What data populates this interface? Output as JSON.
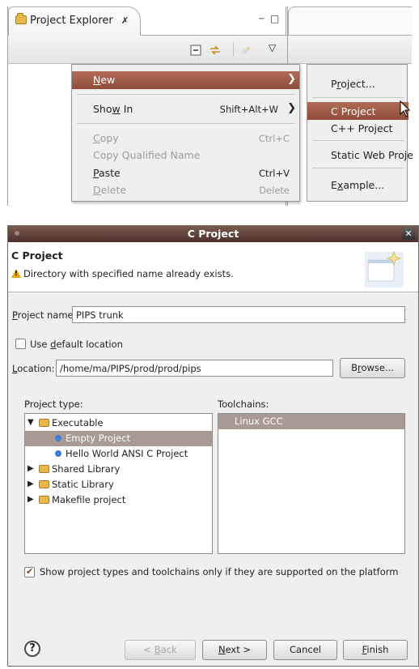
{
  "explorer": {
    "tab_title": "Project Explorer",
    "tab_close": "✗",
    "minimize": "−",
    "maximize": "□",
    "view_menu": "▽"
  },
  "context_menu": {
    "items": [
      {
        "label": "New",
        "mnemonic": "N",
        "accelerator": "",
        "has_submenu": true,
        "highlighted": true,
        "disabled": false
      },
      {
        "label": "Show In",
        "accelerator": "Shift+Alt+W",
        "has_submenu": true,
        "highlighted": false,
        "disabled": false
      },
      {
        "label": "Copy",
        "accelerator": "Ctrl+C",
        "has_submenu": false,
        "highlighted": false,
        "disabled": true
      },
      {
        "label": "Copy Qualified Name",
        "accelerator": "",
        "has_submenu": false,
        "highlighted": false,
        "disabled": true
      },
      {
        "label": "Paste",
        "accelerator": "Ctrl+V",
        "has_submenu": false,
        "highlighted": false,
        "disabled": false
      },
      {
        "label": "Delete",
        "accelerator": "Delete",
        "has_submenu": false,
        "highlighted": false,
        "disabled": true
      }
    ],
    "submenu_arrow": "❯"
  },
  "new_submenu": {
    "items": [
      {
        "label": "Project...",
        "highlighted": false
      },
      {
        "label": "C Project",
        "highlighted": true
      },
      {
        "label": "C++ Project",
        "highlighted": false
      },
      {
        "label": "Static Web Proje",
        "highlighted": false
      },
      {
        "label": "Example...",
        "highlighted": false
      }
    ]
  },
  "dialog": {
    "title": "C Project",
    "close": "✕",
    "header": "C Project",
    "message": "Directory with specified name already exists.",
    "project_name_label": "Project name:",
    "project_name_value": "PIPS trunk",
    "use_default_location_label": "Use default location",
    "use_default_location_checked": false,
    "location_label": "Location:",
    "location_value": "/home/ma/PIPS/prod/prod/pips",
    "browse_label": "Browse...",
    "project_type_label": "Project type:",
    "toolchains_label": "Toolchains:",
    "project_types": [
      {
        "label": "Executable",
        "level": 0,
        "expanded": true,
        "kind": "folder",
        "selected": false
      },
      {
        "label": "Empty Project",
        "level": 1,
        "kind": "item",
        "selected": true
      },
      {
        "label": "Hello World ANSI C Project",
        "level": 1,
        "kind": "item",
        "selected": false
      },
      {
        "label": "Shared Library",
        "level": 0,
        "expanded": false,
        "kind": "folder",
        "selected": false
      },
      {
        "label": "Static Library",
        "level": 0,
        "expanded": false,
        "kind": "folder",
        "selected": false
      },
      {
        "label": "Makefile project",
        "level": 0,
        "expanded": false,
        "kind": "folder",
        "selected": false
      }
    ],
    "toolchains": [
      "Linux GCC"
    ],
    "show_supported_label": "Show project types and toolchains only if they are supported on the platform",
    "show_supported_checked": true,
    "check_mark": "✔",
    "help_label": "?",
    "back_label": "< Back",
    "next_label": "Next >",
    "cancel_label": "Cancel",
    "finish_label": "Finish"
  }
}
